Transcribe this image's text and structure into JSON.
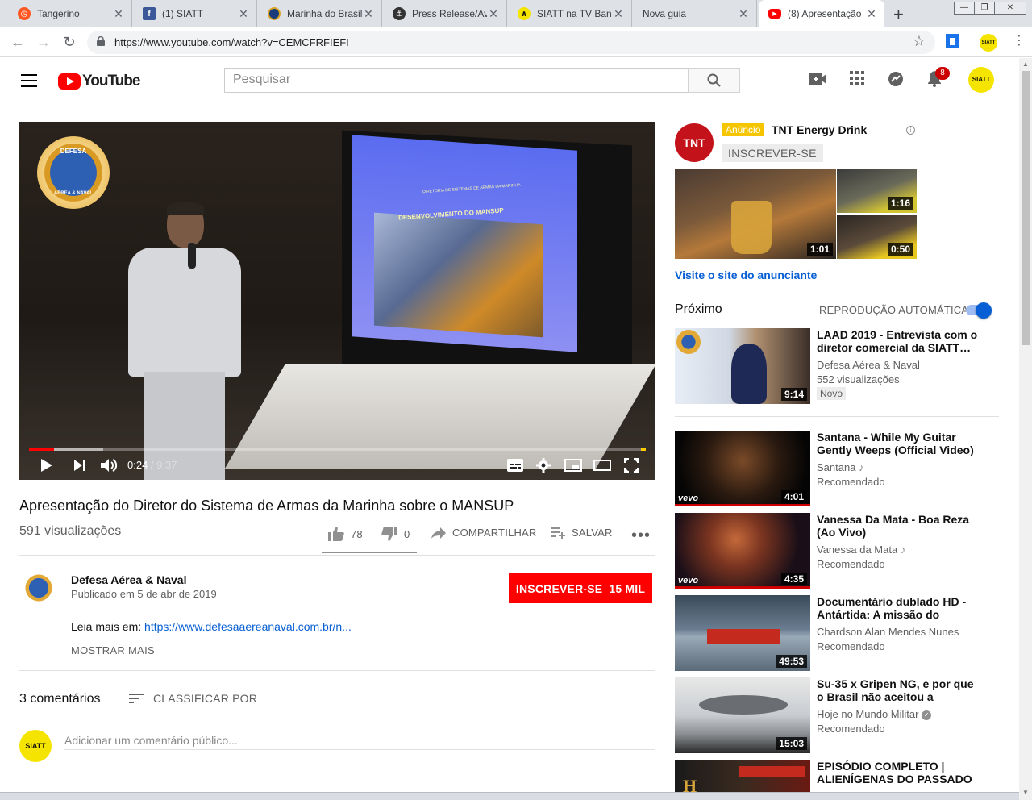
{
  "browser": {
    "tabs": [
      {
        "title": "Tangerino",
        "icon": "clock-icon",
        "color": "#ff5722"
      },
      {
        "title": "(1) SIATT",
        "icon": "facebook-icon",
        "color": "#3b5998"
      },
      {
        "title": "Marinha do Brasil",
        "icon": "navy-emblem-icon",
        "color": "#1a3c7a"
      },
      {
        "title": "Press Release/Av",
        "icon": "press-emblem-icon",
        "color": "#333333"
      },
      {
        "title": "SIATT na TV Banc",
        "icon": "siatt-icon",
        "color": "#f5e400"
      },
      {
        "title": "Nova guia",
        "icon": "",
        "color": ""
      },
      {
        "title": "(8) Apresentação",
        "icon": "youtube-icon",
        "color": "#ff0000"
      }
    ],
    "url": "https://www.youtube.com/watch?v=CEMCFRFIEFI"
  },
  "masthead": {
    "logo_text": "YouTube",
    "search_placeholder": "Pesquisar",
    "notifications": "8",
    "avatar_text": "SIATT"
  },
  "player": {
    "overlay_badge_top": "DEFESA",
    "overlay_badge_bottom": "AÉREA & NAVAL",
    "slide_header": "DIRETORIA DE SISTEMAS DE ARMAS DA MARINHA",
    "slide_title": "DESENVOLVIMENTO DO MANSUP",
    "current_time": "0:24",
    "duration": "9:37",
    "progress": 0.04
  },
  "video": {
    "title": "Apresentação do Diretor do Sistema de Armas da Marinha sobre o MANSUP",
    "views": "591 visualizações",
    "likes": "78",
    "dislikes": "0",
    "share": "COMPARTILHAR",
    "save": "SALVAR"
  },
  "channel": {
    "name": "Defesa Aérea & Naval",
    "published": "Publicado em 5 de abr de 2019",
    "subscribe_label": "INSCREVER-SE",
    "subscriber_count": "15 MIL",
    "desc_prefix": "Leia mais em: ",
    "desc_link": "https://www.defesaaereanaval.com.br/n...",
    "show_more": "MOSTRAR MAIS"
  },
  "comments": {
    "count": "3 comentários",
    "sort_label": "CLASSIFICAR POR",
    "placeholder": "Adicionar um comentário público...",
    "avatar_text": "SIATT"
  },
  "ad": {
    "logo_text": "TNT",
    "badge": "Anúncio",
    "name": "TNT Energy Drink",
    "subscribe": "INSCREVER-SE",
    "thumbs": [
      {
        "duration": "1:01"
      },
      {
        "duration": "1:16"
      },
      {
        "duration": "0:50"
      }
    ],
    "visit_link": "Visite o site do anunciante"
  },
  "upnext": {
    "label": "Próximo",
    "autoplay_label": "REPRODUÇÃO AUTOMÁTICA",
    "autoplay_on": true
  },
  "recommendations": [
    {
      "title": "LAAD 2019 - Entrevista com o diretor comercial da SIATT…",
      "channel": "Defesa Aérea & Naval",
      "meta": "552 visualizações",
      "badge": "Novo",
      "duration": "9:14"
    },
    {
      "title": "Santana - While My Guitar Gently Weeps (Official Video)",
      "channel": "Santana",
      "meta": "Recomendado",
      "duration": "4:01",
      "logo": "vevo"
    },
    {
      "title": "Vanessa Da Mata - Boa Reza (Ao Vivo)",
      "channel": "Vanessa da Mata",
      "meta": "Recomendado",
      "duration": "4:35",
      "logo": "vevo"
    },
    {
      "title": "Documentário dublado HD - Antártida: A missão do quebra…",
      "channel": "Chardson Alan Mendes Nunes",
      "meta": "Recomendado",
      "duration": "49:53"
    },
    {
      "title": "Su-35 x Gripen NG, e por que o Brasil não aceitou a proposta…",
      "channel": "Hoje no Mundo Militar",
      "meta": "Recomendado",
      "duration": "15:03"
    },
    {
      "title": "EPISÓDIO COMPLETO | ALIENÍGENAS DO PASSADO |…",
      "channel": "",
      "meta": "",
      "duration": ""
    }
  ]
}
